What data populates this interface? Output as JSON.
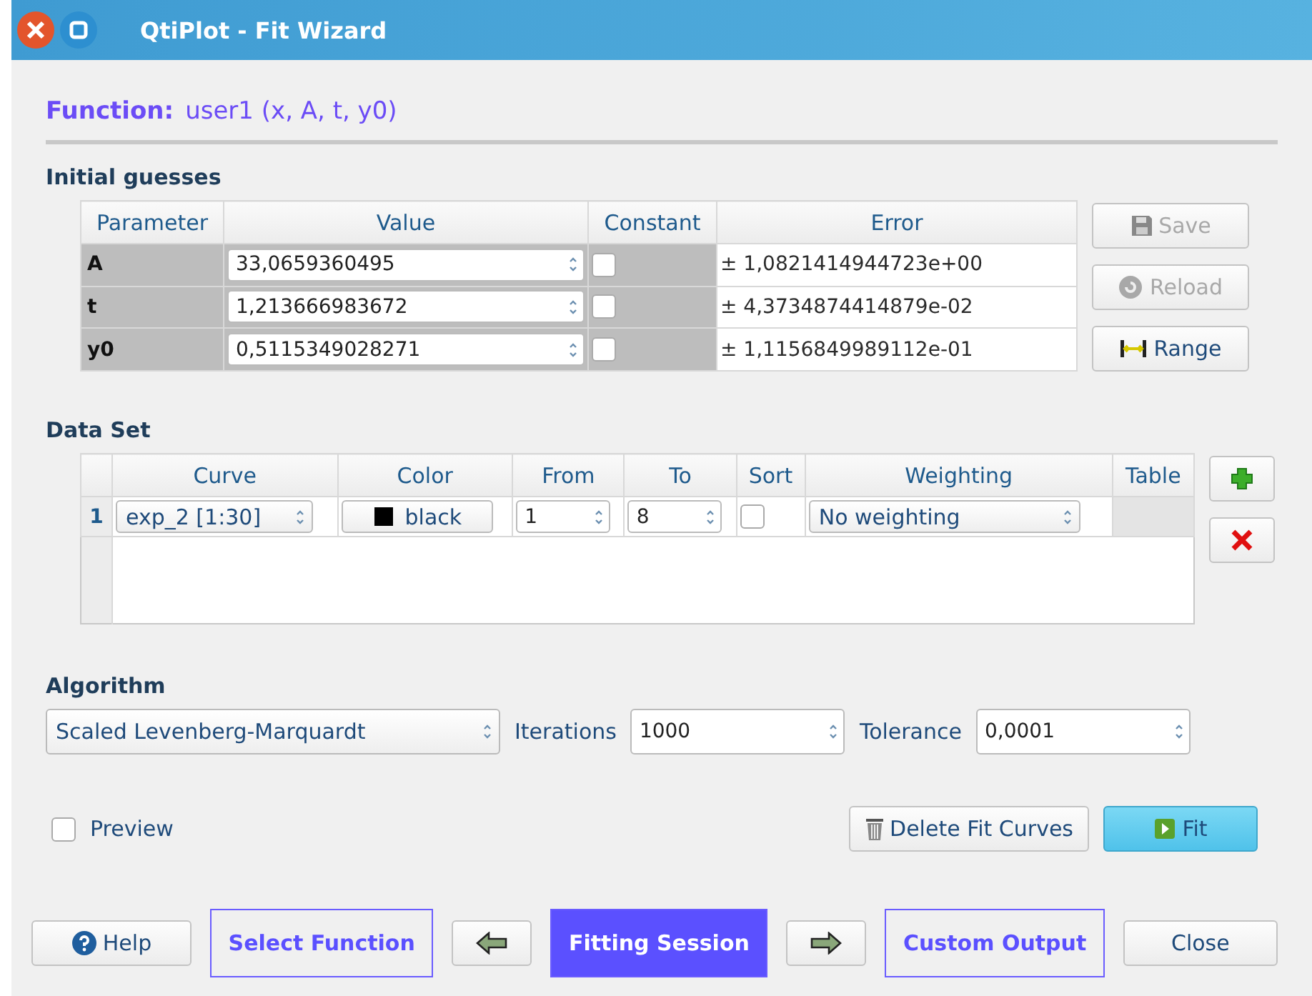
{
  "window": {
    "title": "QtiPlot - Fit Wizard"
  },
  "function_label": "Function:",
  "function_name": "user1 (x, A, t, y0)",
  "initial_guesses": {
    "title": "Initial guesses",
    "columns": [
      "Parameter",
      "Value",
      "Constant",
      "Error"
    ],
    "rows": [
      {
        "parameter": "A",
        "value": "33,0659360495",
        "constant": false,
        "error": "± 1,0821414944723e+00"
      },
      {
        "parameter": "t",
        "value": "1,213666983672",
        "constant": false,
        "error": "± 4,3734874414879e-02"
      },
      {
        "parameter": "y0",
        "value": "0,5115349028271",
        "constant": false,
        "error": "± 1,1156849989112e-01"
      }
    ],
    "buttons": [
      {
        "kind": "save",
        "label": "Save",
        "disabled": true
      },
      {
        "kind": "reload",
        "label": "Reload",
        "disabled": true
      },
      {
        "kind": "range",
        "label": "Range",
        "disabled": false
      }
    ]
  },
  "data_set": {
    "title": "Data Set",
    "columns": [
      "Curve",
      "Color",
      "From",
      "To",
      "Sort",
      "Weighting",
      "Table"
    ],
    "rows": [
      {
        "index": "1",
        "curve": "exp_2 [1:30]",
        "color_name": "black",
        "color": "#000000",
        "from": "1",
        "to": "8",
        "sort": false,
        "weighting": "No weighting"
      }
    ]
  },
  "algorithm": {
    "title": "Algorithm",
    "method": "Scaled Levenberg-Marquardt",
    "iterations_label": "Iterations",
    "iterations": "1000",
    "tolerance_label": "Tolerance",
    "tolerance": "0,0001"
  },
  "preview": {
    "label": "Preview",
    "checked": false
  },
  "actions": [
    {
      "kind": "delete",
      "label": "Delete Fit Curves",
      "default": false
    },
    {
      "kind": "fit",
      "label": "Fit",
      "default": true
    }
  ],
  "help": {
    "label": "Help"
  },
  "steps": [
    {
      "label": "Select Function",
      "selected": false
    },
    {
      "label": "Fitting Session",
      "selected": true
    },
    {
      "label": "Custom Output",
      "selected": false
    }
  ],
  "close": {
    "label": "Close"
  }
}
